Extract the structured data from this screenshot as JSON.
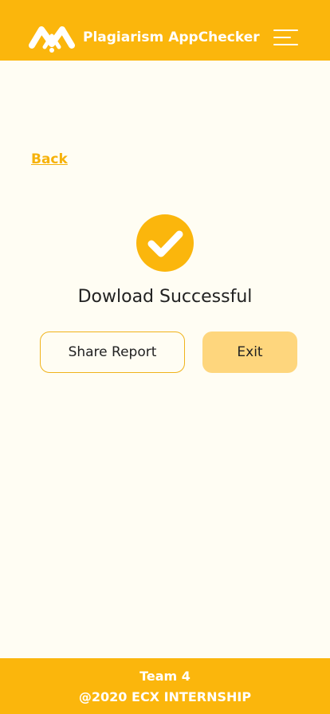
{
  "header": {
    "app_title": "Plagiarism AppChecker",
    "logo_icon": "mm-logo-icon",
    "menu_icon": "hamburger-menu-icon"
  },
  "main": {
    "back_label": "Back",
    "status_icon": "check-circle-icon",
    "status_text": "Dowload Successful",
    "share_button_label": "Share Report",
    "exit_button_label": "Exit"
  },
  "footer": {
    "team": "Team 4",
    "copyright": "@2020 ECX INTERNSHIP"
  },
  "colors": {
    "brand_yellow": "#FBB60C",
    "background": "#FFFDF3",
    "exit_button_bg": "#FED67D",
    "link": "#F6B20A"
  }
}
